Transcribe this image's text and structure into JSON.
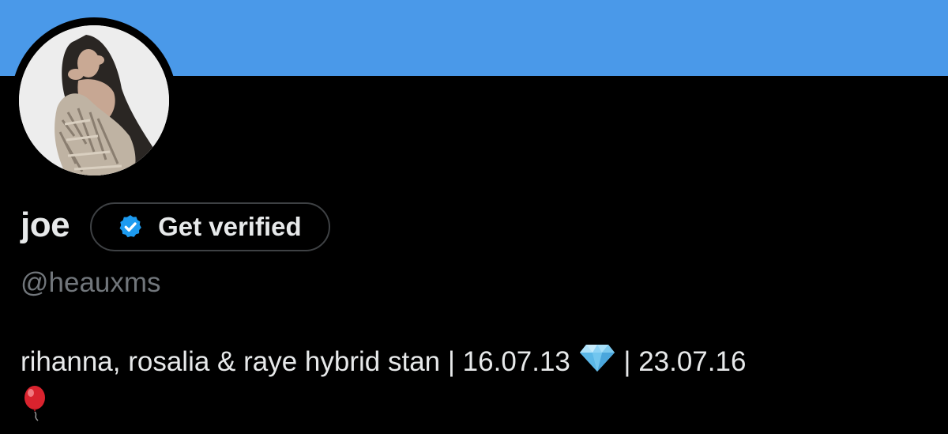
{
  "profile": {
    "display_name": "joe",
    "handle": "@heauxms",
    "bio_text": "rihanna, rosalia & raye hybrid stan | 16.07.13",
    "bio_separator_date": "| 23.07.16",
    "bio_emoji_1": "gem-stone-icon",
    "bio_emoji_2": "balloon-icon"
  },
  "verify": {
    "label": "Get verified",
    "icon": "verified-badge-icon"
  },
  "colors": {
    "banner": "#4a99e9",
    "background": "#000000",
    "text_primary": "#e7e9ea",
    "text_secondary": "#71767b",
    "verified_blue": "#1d9bf0"
  }
}
